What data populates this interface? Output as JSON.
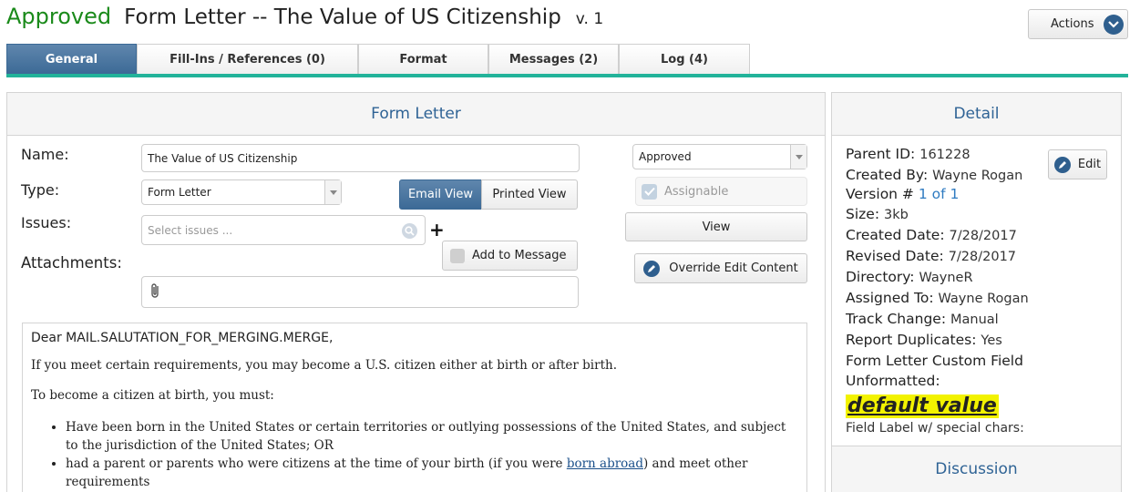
{
  "header": {
    "status": "Approved",
    "title": "Form Letter --  The Value of US Citizenship",
    "version": "v. 1",
    "actions_label": "Actions"
  },
  "tabs": [
    {
      "label": "General"
    },
    {
      "label": "Fill-Ins / References (0)"
    },
    {
      "label": "Format"
    },
    {
      "label": "Messages (2)"
    },
    {
      "label": "Log (4)"
    }
  ],
  "form_panel": {
    "title": "Form Letter",
    "name_label": "Name:",
    "name_value": "The Value of US Citizenship",
    "type_label": "Type:",
    "type_value": "Form Letter",
    "issues_label": "Issues:",
    "issues_placeholder": "Select issues ...",
    "attachments_label": "Attachments:",
    "status_value": "Approved",
    "assignable_label": "Assignable",
    "email_view_label": "Email View",
    "printed_view_label": "Printed View",
    "view_label": "View",
    "add_to_message_label": "Add to Message",
    "override_label": "Override Edit Content"
  },
  "letter": {
    "salutation": "Dear MAIL.SALUTATION_FOR_MERGING.MERGE,",
    "para1": "If you meet certain requirements, you may become a U.S. citizen either at birth or after birth.",
    "para2": "To become a citizen at birth, you must:",
    "bullet1": "Have been born in the United States or certain territories or outlying possessions of the United States, and subject to the jurisdiction of the United States; OR",
    "bullet2_pre": "had a parent or parents who were citizens at the time of your birth (if you were ",
    "bullet2_link": "born abroad",
    "bullet2_post": ") and meet other requirements"
  },
  "detail_panel": {
    "title": "Detail",
    "edit_label": "Edit",
    "parent_id_label": "Parent ID:",
    "parent_id": "161228",
    "created_by_label": "Created By:",
    "created_by": "Wayne Rogan",
    "version_label": "Version #",
    "version": "1 of 1",
    "size_label": "Size:",
    "size": "3kb",
    "created_date_label": "Created Date:",
    "created_date": "7/28/2017",
    "revised_date_label": "Revised Date:",
    "revised_date": "7/28/2017",
    "directory_label": "Directory:",
    "directory": "WayneR",
    "assigned_to_label": "Assigned To:",
    "assigned_to": "Wayne Rogan",
    "track_change_label": "Track Change:",
    "track_change": "Manual",
    "report_duplicates_label": "Report Duplicates:",
    "report_duplicates": "Yes",
    "custom_field_label": "Form Letter Custom Field Unformatted:",
    "custom_field_value": "default value",
    "special_label": "Field Label w/ special chars:",
    "discussion_title": "Discussion"
  },
  "colors": {
    "accent": "#22b39a",
    "primary": "#3c6a96",
    "approved": "#1a8a1a",
    "highlight": "#f2f200"
  }
}
